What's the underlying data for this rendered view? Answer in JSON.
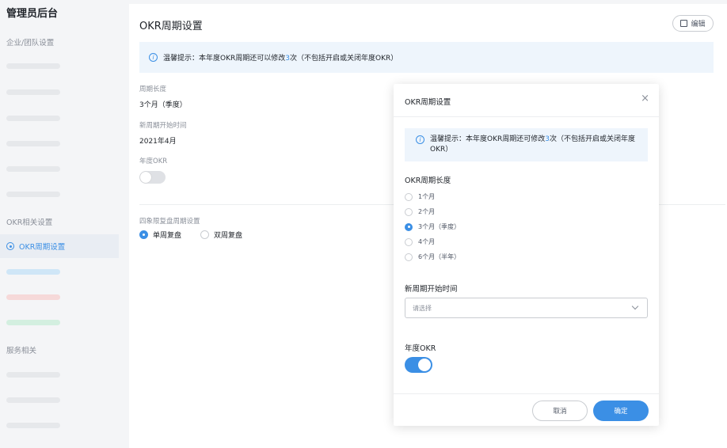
{
  "sidebar": {
    "brand": "管理员后台",
    "group1": "企业/团队设置",
    "group2": "OKR相关设置",
    "active_item": "OKR周期设置",
    "group3": "服务相关"
  },
  "main": {
    "title": "OKR周期设置",
    "edit_label": "编辑",
    "notice_prefix": "温馨提示：本年度OKR周期还可以修改",
    "notice_count": "3",
    "notice_suffix": "次（不包括开启或关闭年度OKR）",
    "cycle_length_label": "周期长度",
    "cycle_length_value": "3个月（季度）",
    "start_time_label": "新周期开始时间",
    "start_time_value": "2021年4月",
    "annual_okr_label": "年度OKR",
    "annual_okr_enabled": false,
    "review_label": "四象限复盘周期设置",
    "review_options": [
      "单周复盘",
      "双周复盘"
    ],
    "review_selected": "单周复盘"
  },
  "modal": {
    "title": "OKR周期设置",
    "close_symbol": "×",
    "notice_prefix": "温馨提示：本年度OKR周期还可修改",
    "notice_count": "3",
    "notice_suffix": "次（不包括开启或关闭年度OKR）",
    "length_title": "OKR周期长度",
    "length_options": [
      "1个月",
      "2个月",
      "3个月（季度）",
      "4个月",
      "6个月（半年）"
    ],
    "length_selected": "3个月（季度）",
    "start_title": "新周期开始时间",
    "start_placeholder": "请选择",
    "annual_title": "年度OKR",
    "annual_enabled": true,
    "cancel_label": "取消",
    "ok_label": "确定"
  },
  "colors": {
    "accent": "#3b8fe5",
    "notice_bg": "#eef5fc"
  }
}
